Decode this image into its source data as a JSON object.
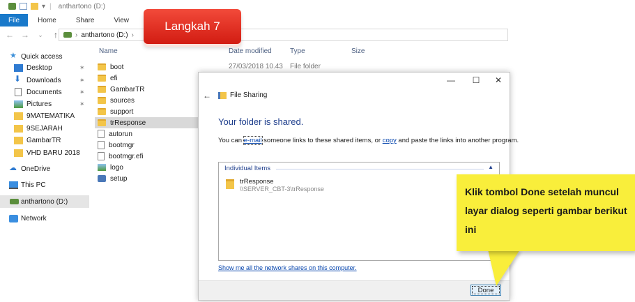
{
  "window": {
    "title": "anthartono (D:)",
    "ribbon_tabs": [
      "File",
      "Home",
      "Share",
      "View"
    ],
    "address": [
      "anthartono (D:)",
      "›"
    ]
  },
  "navpane": {
    "items": [
      {
        "label": "Quick access",
        "icon": "star-icon",
        "pinned": false
      },
      {
        "label": "Desktop",
        "icon": "desktop-icon",
        "pinned": true
      },
      {
        "label": "Downloads",
        "icon": "download-icon",
        "pinned": true
      },
      {
        "label": "Documents",
        "icon": "documents-icon",
        "pinned": true
      },
      {
        "label": "Pictures",
        "icon": "pictures-icon",
        "pinned": true
      },
      {
        "label": "9MATEMATIKA",
        "icon": "folder-icon",
        "pinned": false
      },
      {
        "label": "9SEJARAH",
        "icon": "folder-icon",
        "pinned": false
      },
      {
        "label": "GambarTR",
        "icon": "folder-icon",
        "pinned": false
      },
      {
        "label": "VHD BARU 2018",
        "icon": "folder-icon",
        "pinned": false
      },
      {
        "label": "OneDrive",
        "icon": "cloud-icon",
        "pinned": false
      },
      {
        "label": "This PC",
        "icon": "computer-icon",
        "pinned": false
      },
      {
        "label": "anthartono (D:)",
        "icon": "drive-icon",
        "pinned": false,
        "selected": true
      },
      {
        "label": "Network",
        "icon": "network-icon",
        "pinned": false
      }
    ],
    "pin_glyph": "📌"
  },
  "filelist": {
    "columns": [
      "Name",
      "Date modified",
      "Type",
      "Size"
    ],
    "files": [
      {
        "name": "boot",
        "kind": "folder"
      },
      {
        "name": "efi",
        "kind": "folder"
      },
      {
        "name": "GambarTR",
        "kind": "folder"
      },
      {
        "name": "sources",
        "kind": "folder"
      },
      {
        "name": "support",
        "kind": "folder"
      },
      {
        "name": "trResponse",
        "kind": "folder",
        "selected": true
      },
      {
        "name": "autorun",
        "kind": "file"
      },
      {
        "name": "bootmgr",
        "kind": "file"
      },
      {
        "name": "bootmgr.efi",
        "kind": "file"
      },
      {
        "name": "logo",
        "kind": "image"
      },
      {
        "name": "setup",
        "kind": "setup"
      }
    ],
    "first_row_date": "27/03/2018 10.43",
    "first_row_type": "File folder"
  },
  "dialog": {
    "title": "File Sharing",
    "minimize": "—",
    "maximize": "☐",
    "close": "✕",
    "back": "←",
    "heading": "Your folder is shared.",
    "message_prefix": "You can ",
    "email_link": "e-mail",
    "message_middle": " someone links to these shared items, or ",
    "copy_link": "copy",
    "message_suffix": " and paste the links into another program.",
    "items_header": "Individual Items",
    "items_caret": "▲",
    "item": {
      "name": "trResponse",
      "path": "\\\\SERVER_CBT-3\\trResponse"
    },
    "show_link": "Show me all the network shares on this computer.",
    "done_label": "Done"
  },
  "annotations": {
    "step_label": "Langkah 7",
    "callout_text": "Klik tombol Done setelah muncul layar dialog seperti gambar berikut ini"
  },
  "colors": {
    "file_tab": "#1979ca",
    "step_badge": "#e0281c",
    "callout": "#f9ee3b",
    "heading_blue": "#1e3e8c",
    "link_blue": "#0645ad"
  }
}
